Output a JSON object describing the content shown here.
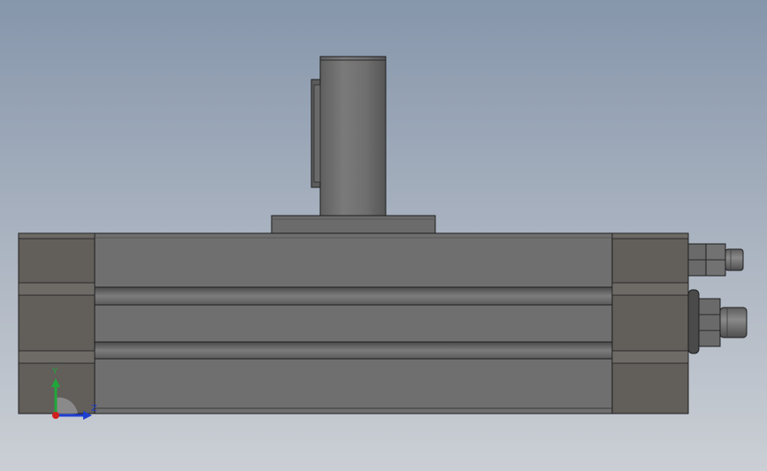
{
  "viewport": {
    "background_top": "#8696ab",
    "background_bottom": "#cbcfd5"
  },
  "model": {
    "body_color": "#6e6e6e",
    "endcap_color": "#625e5a",
    "edge_color": "#1e1e1e"
  },
  "triad": {
    "y_label": "Y",
    "z_label": "Z",
    "y_color": "#1fa83a",
    "z_color": "#1f3fd0",
    "origin_color": "#d01f1f"
  }
}
